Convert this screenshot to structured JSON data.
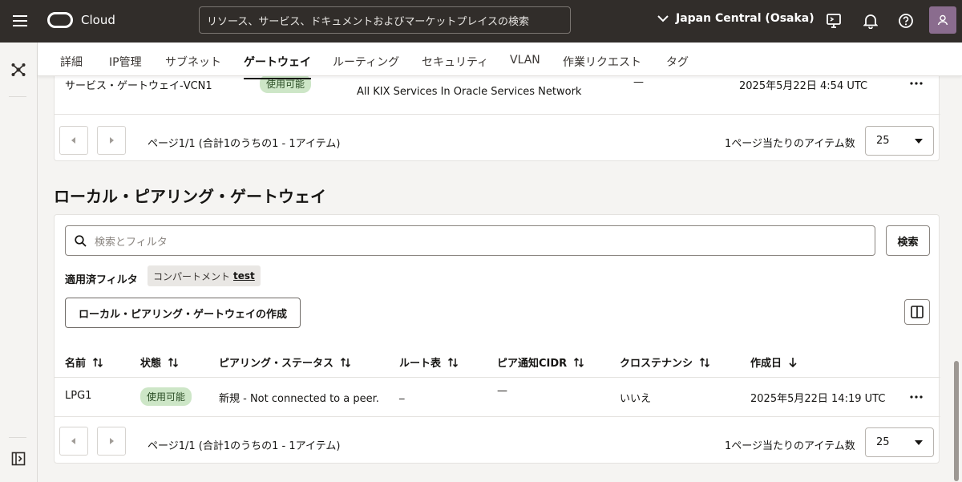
{
  "header": {
    "brand": "Cloud",
    "search_placeholder": "リソース、サービス、ドキュメントおよびマーケットプレイスの検索",
    "region": "Japan Central (Osaka)"
  },
  "tabs": [
    {
      "label": "詳細"
    },
    {
      "label": "IP管理"
    },
    {
      "label": "サブネット"
    },
    {
      "label": "ゲートウェイ",
      "active": true
    },
    {
      "label": "ルーティング"
    },
    {
      "label": "セキュリティ"
    },
    {
      "label": "VLAN"
    },
    {
      "label": "作業リクエスト"
    },
    {
      "label": "タグ"
    }
  ],
  "service_gateway_section": {
    "row": {
      "name": "サービス・ゲートウェイ-VCN1",
      "status": "使用可能",
      "services": "All KIX Services In Oracle Services Network",
      "route_table": "—",
      "created": "2025年5月22日 4:54 UTC"
    },
    "pagination": {
      "summary": "ページ1/1 (合計1のうちの1 - 1アイテム)",
      "per_page_label": "1ページ当たりのアイテム数",
      "per_page_value": "25"
    }
  },
  "lpg_section": {
    "title": "ローカル・ピアリング・ゲートウェイ",
    "search_placeholder": "検索とフィルタ",
    "search_button": "検索",
    "applied_filters_label": "適用済フィルタ",
    "filter_chip": {
      "label": "コンパートメント",
      "value": "test"
    },
    "create_button": "ローカル・ピアリング・ゲートウェイの作成",
    "columns": [
      "名前",
      "状態",
      "ピアリング・ステータス",
      "ルート表",
      "ピア通知CIDR",
      "クロステナンシ",
      "作成日"
    ],
    "rows": [
      {
        "name": "LPG1",
        "status": "使用可能",
        "peering_status": "新規 - Not connected to a peer.",
        "route_table": "_",
        "peer_cidr": "—",
        "cross_tenancy": "いいえ",
        "created": "2025年5月22日 14:19 UTC"
      }
    ],
    "pagination": {
      "summary": "ページ1/1 (合計1のうちの1 - 1アイテム)",
      "per_page_label": "1ページ当たりのアイテム数",
      "per_page_value": "25"
    }
  },
  "colors": {
    "header_bg": "#312d2a",
    "badge_bg": "#cde6c7",
    "page_bg": "#f5f4f2"
  }
}
